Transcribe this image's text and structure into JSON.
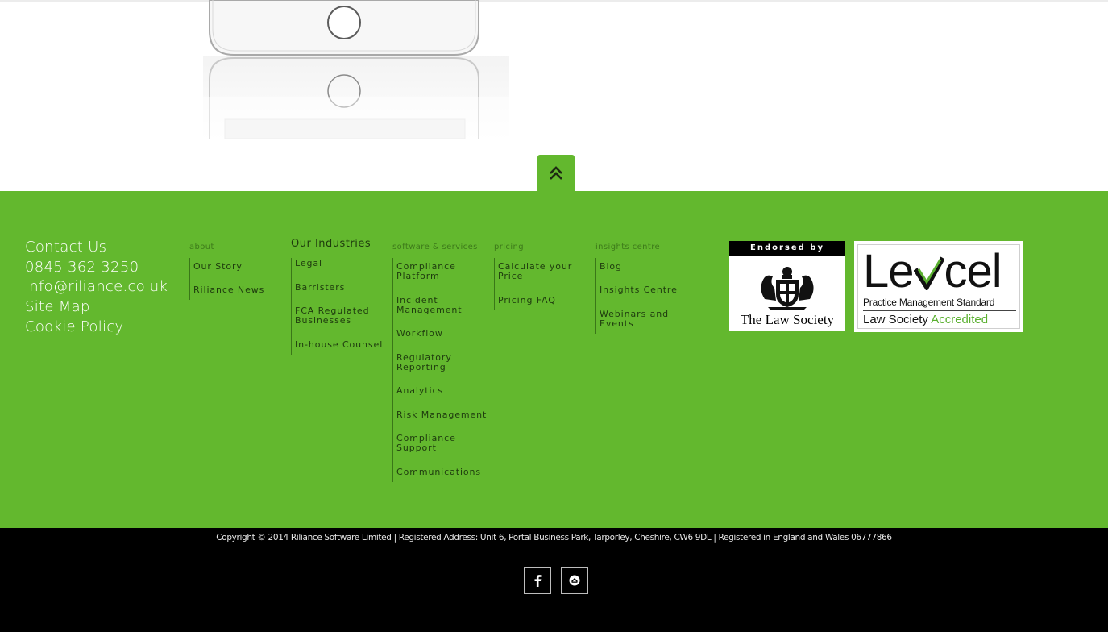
{
  "scroll_top": {
    "icon": "double-chevron-up-icon"
  },
  "contact": {
    "contact_us": "Contact Us",
    "phone": "0845 362 3250",
    "email": "info@riliance.co.uk",
    "site_map": "Site Map",
    "cookie_policy": "Cookie Policy"
  },
  "columns": {
    "about": {
      "heading": "about",
      "items": [
        "Our Story",
        "Riliance News"
      ]
    },
    "industries": {
      "heading": "Our Industries",
      "items": [
        "Legal",
        "Barristers",
        "FCA Regulated Businesses",
        "In-house Counsel"
      ]
    },
    "software": {
      "heading": "software & services",
      "items": [
        "Compliance Platform",
        "Incident Management",
        "Workflow",
        "Regulatory Reporting",
        "Analytics",
        "Risk Management",
        "Compliance Support",
        "Communications"
      ]
    },
    "pricing": {
      "heading": "pricing",
      "items": [
        "Calculate your Price",
        "Pricing FAQ"
      ]
    },
    "insights": {
      "heading": "insights centre",
      "items": [
        "Blog",
        "Insights Centre",
        "Webinars and Events"
      ]
    }
  },
  "badges": {
    "law_society": {
      "band": "Endorsed by",
      "name": "The Law Society"
    },
    "lexcel": {
      "word_a": "Le",
      "word_b": "cel",
      "subtitle": "Practice Management Standard",
      "bottom_a": "Law Society",
      "bottom_b": "Accredited"
    }
  },
  "footer": {
    "copyright": "Copyright © 2014 Riliance Software Limited | Registered Address: Unit 6, Portal Business Park, Tarporley, Cheshire, CW6 9DL | Registered in England and Wales 06777866"
  },
  "social": [
    {
      "icon": "facebook-icon"
    },
    {
      "icon": "email-icon"
    }
  ],
  "colors": {
    "green": "#63b82e",
    "black": "#000000",
    "text_dark": "#1e3b0e"
  }
}
